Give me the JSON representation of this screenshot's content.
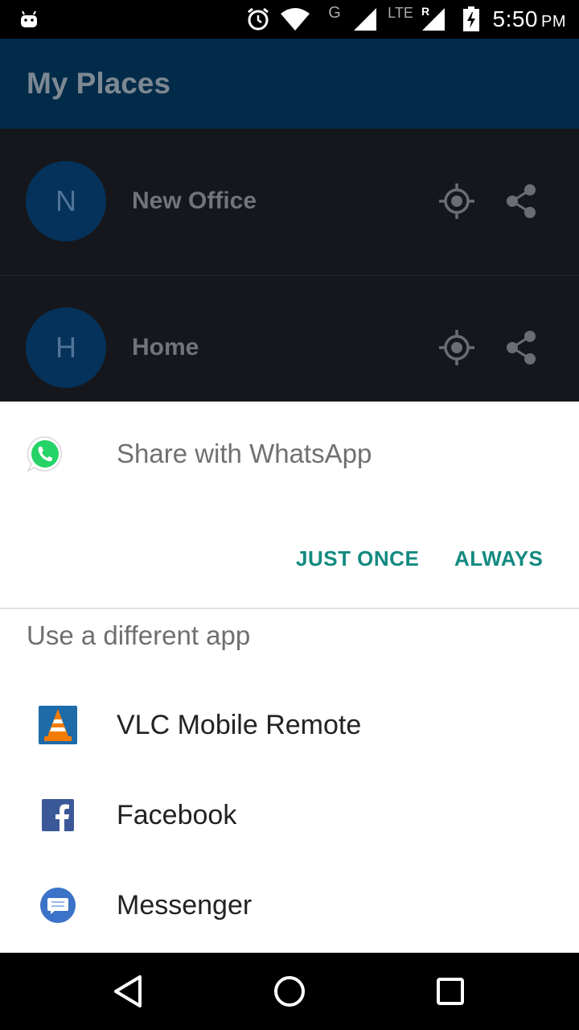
{
  "status_bar": {
    "time": "5:50",
    "ampm": "PM",
    "network_g_label": "G",
    "network_lte_label": "LTE",
    "roaming_label": "R",
    "icons": [
      "android-icon",
      "alarm-icon",
      "wifi-icon",
      "signal-icon",
      "signal-lte-icon",
      "battery-charging-icon"
    ]
  },
  "app": {
    "title": "My Places",
    "places": [
      {
        "initial": "N",
        "name": "New Office"
      },
      {
        "initial": "H",
        "name": "Home"
      }
    ],
    "colors": {
      "app_bar": "#012b48",
      "avatar": "#05325a",
      "background": "#15171c"
    }
  },
  "sheet": {
    "share_title": "Share with WhatsApp",
    "just_once_label": "JUST ONCE",
    "always_label": "ALWAYS",
    "section_title": "Use a different app",
    "apps": [
      {
        "label": "VLC Mobile Remote",
        "icon": "vlc-icon"
      },
      {
        "label": "Facebook",
        "icon": "facebook-icon"
      },
      {
        "label": "Messenger",
        "icon": "messenger-icon"
      }
    ],
    "colors": {
      "accent": "#138a80",
      "whatsapp": "#25d366",
      "facebook": "#3b5998",
      "messenger": "#3a73c8",
      "vlc": "#f57c00"
    }
  },
  "nav_bar": {
    "icons": [
      "back-icon",
      "home-icon",
      "recents-icon"
    ]
  }
}
